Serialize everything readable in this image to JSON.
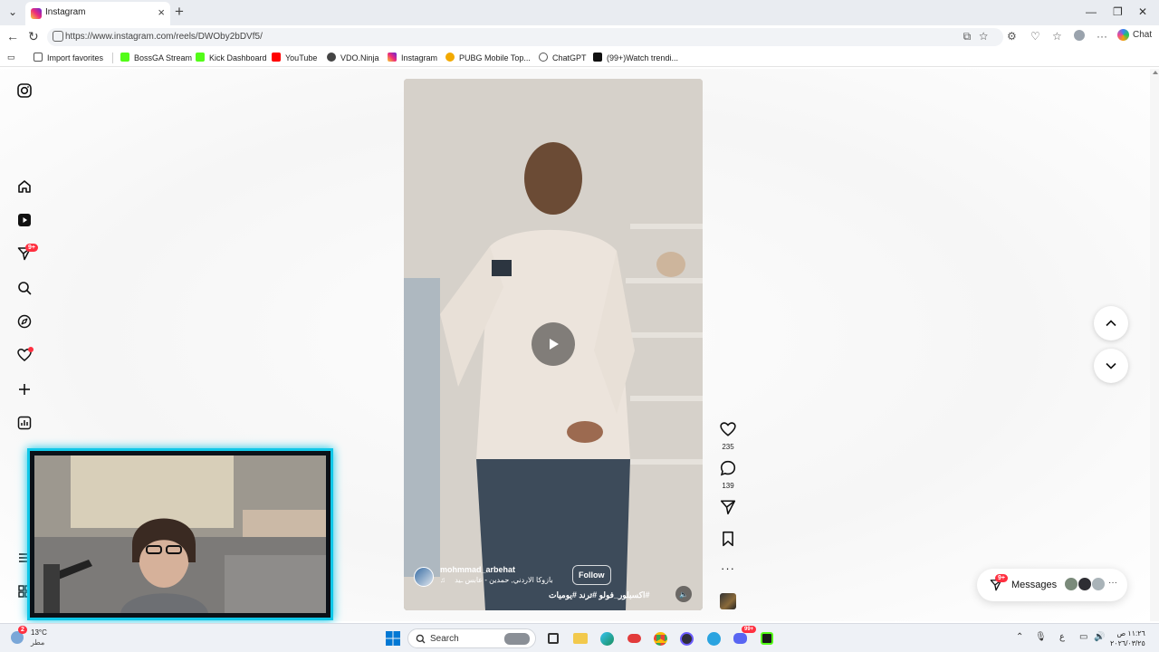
{
  "browser": {
    "tab_title": "Instagram",
    "url": "https://www.instagram.com/reels/DWOby2bDVf5/",
    "chat_label": "Chat",
    "bookmarks": [
      {
        "label": "Import favorites"
      },
      {
        "label": "BossGA Stream"
      },
      {
        "label": "Kick Dashboard"
      },
      {
        "label": "YouTube"
      },
      {
        "label": "VDO.Ninja"
      },
      {
        "label": "Instagram"
      },
      {
        "label": "PUBG Mobile Top..."
      },
      {
        "label": "ChatGPT"
      },
      {
        "label": "(99+)Watch trendi..."
      }
    ]
  },
  "sidebar": {
    "notifications_badge": "9+"
  },
  "reel": {
    "username": "mohmmad_arbehat",
    "audio": "بازوكا الاردني, حمدين - عابس",
    "audio_extra": "ـيد",
    "follow_label": "Follow",
    "caption": "#اكسبلور_فولو #ترند #يوميات",
    "likes": "235",
    "comments": "139"
  },
  "messages": {
    "label": "Messages",
    "badge": "9+"
  },
  "taskbar": {
    "search_placeholder": "Search",
    "weather_temp": "13°C",
    "weather_desc": "مطر",
    "weather_badge": "2",
    "lang": "ع",
    "time": "١١:٢٦ ص",
    "date": "٢٠٢٦/٠٣/٢٥",
    "discord_badge": "99+"
  },
  "colors": {
    "accent_cyan": "#10c7e8",
    "badge_red": "#ff3040"
  }
}
